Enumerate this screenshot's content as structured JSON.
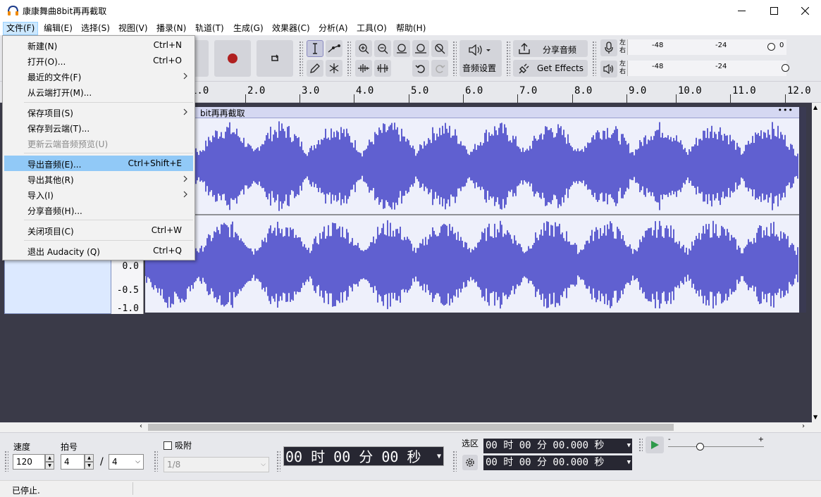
{
  "window": {
    "title": "康康舞曲8bit再再截取"
  },
  "menubar": [
    {
      "id": "file",
      "label": "文件(F)"
    },
    {
      "id": "edit",
      "label": "编辑(E)"
    },
    {
      "id": "select",
      "label": "选择(S)"
    },
    {
      "id": "view",
      "label": "视图(V)"
    },
    {
      "id": "record",
      "label": "播录(N)"
    },
    {
      "id": "tracks",
      "label": "轨道(T)"
    },
    {
      "id": "generate",
      "label": "生成(G)"
    },
    {
      "id": "effect",
      "label": "效果器(C)"
    },
    {
      "id": "analyze",
      "label": "分析(A)"
    },
    {
      "id": "tools",
      "label": "工具(O)"
    },
    {
      "id": "help",
      "label": "帮助(H)"
    }
  ],
  "file_menu": [
    {
      "label": "新建(N)",
      "shortcut": "Ctrl+N"
    },
    {
      "label": "打开(O)...",
      "shortcut": "Ctrl+O"
    },
    {
      "label": "最近的文件(F)",
      "shortcut": ""
    },
    {
      "label": "从云端打开(M)...",
      "shortcut": ""
    },
    {
      "label": "保存项目(S)",
      "shortcut": ""
    },
    {
      "label": "保存到云端(T)...",
      "shortcut": ""
    },
    {
      "label": "更新云端音频预览(U)",
      "shortcut": ""
    },
    {
      "label": "导出音频(E)...",
      "shortcut": "Ctrl+Shift+E"
    },
    {
      "label": "导出其他(R)",
      "shortcut": ""
    },
    {
      "label": "导入(I)",
      "shortcut": ""
    },
    {
      "label": "分享音频(H)...",
      "shortcut": ""
    },
    {
      "label": "关闭项目(C)",
      "shortcut": "Ctrl+W"
    },
    {
      "label": "退出 Audacity (Q)",
      "shortcut": "Ctrl+Q"
    }
  ],
  "toolbar": {
    "audio_setup": "音频设置",
    "share_audio": "分享音频",
    "get_effects": "Get Effects",
    "meter_lr_top": "左",
    "meter_lr_bottom": "右",
    "meter_ticks": [
      "-48",
      "-24",
      "0"
    ]
  },
  "ruler": {
    "labels": [
      "1.0",
      "2.0",
      "3.0",
      "4.0",
      "5.0",
      "6.0",
      "7.0",
      "8.0",
      "9.0",
      "10.0",
      "11.0",
      "12.0"
    ]
  },
  "track": {
    "clip_name": "bit再再截取",
    "clip_menu": "•••",
    "vruler": [
      "0.0",
      "-0.5",
      "-1.0"
    ]
  },
  "bottom": {
    "tempo_label": "速度",
    "tempo_value": "120",
    "meter_label": "拍号",
    "meter_num": "4",
    "meter_slash": "/",
    "meter_den": "4",
    "snap_label": "吸附",
    "snap_value": "1/8",
    "time_main": "00 时 00 分 00 秒",
    "selection_label": "选区",
    "sel_start": "00 时 00 分 00.000 秒",
    "sel_end": "00 时 00 分 00.000 秒",
    "speed_minus": "-",
    "speed_plus": "+"
  },
  "status": {
    "text": "已停止."
  },
  "colors": {
    "wave": "#6060d0",
    "menu_highlight": "#91c9f7",
    "record_red": "#b02020"
  }
}
